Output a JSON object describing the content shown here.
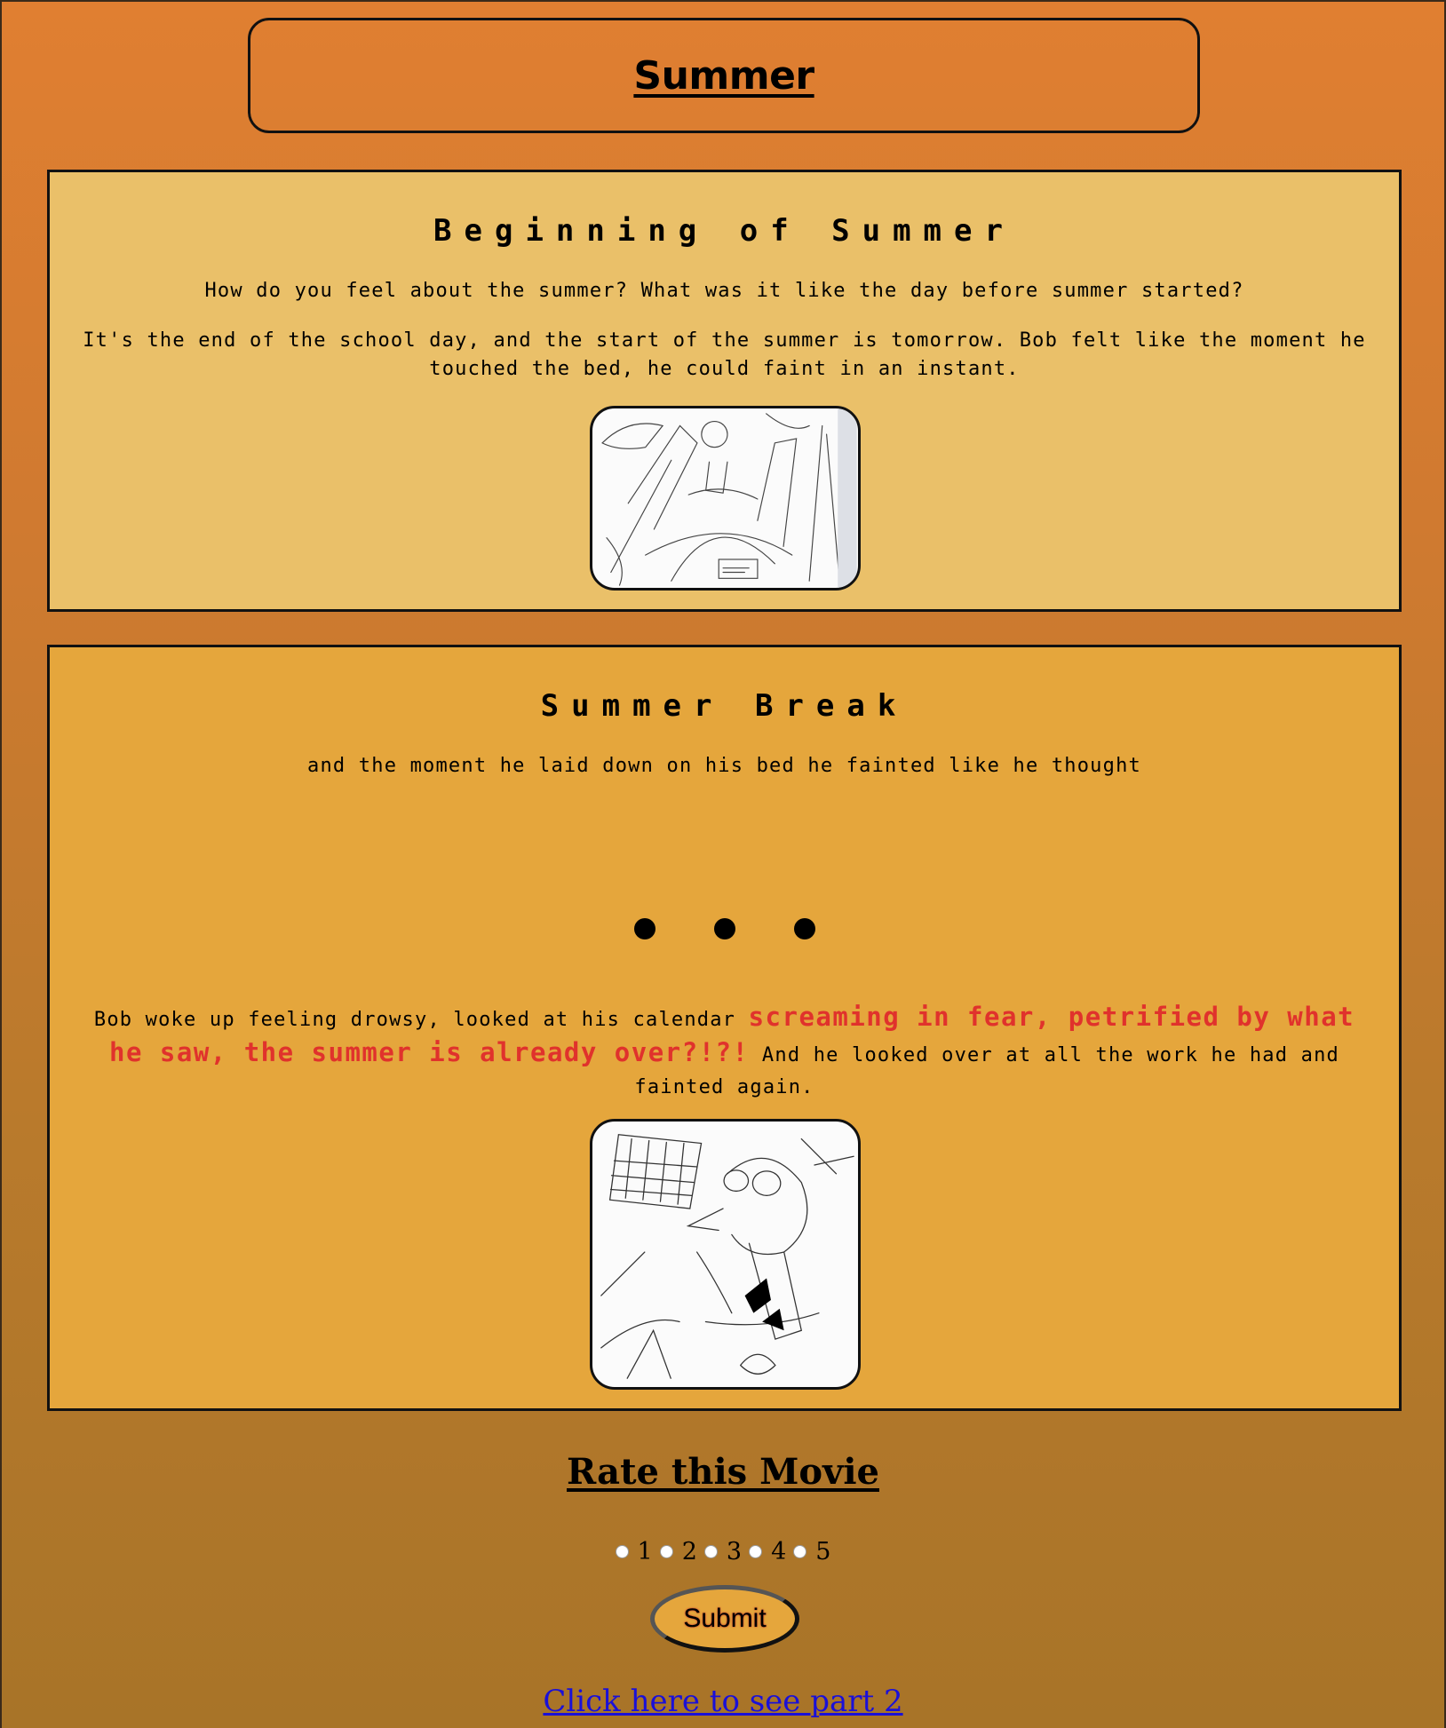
{
  "page": {
    "title": "Summer"
  },
  "sections": [
    {
      "heading": "Beginning of Summer",
      "prompt": "How do you feel about the summer? What was it like the day before summer started?",
      "story": "It's the end of the school day, and the start of the summer is tomorrow. Bob felt like the moment he touched the bed, he could faint in an instant."
    },
    {
      "heading": "Summer Break",
      "intro": "and the moment he laid down on his bed he fainted like he thought",
      "story_before": "Bob woke up feeling drowsy, looked at his calendar ",
      "story_emphasis": "screaming in fear, petrified by what he saw, the summer is already over?!?!",
      "story_after": " And he looked over at all the work he had and fainted again."
    }
  ],
  "rating": {
    "title": "Rate this Movie",
    "options": [
      "1",
      "2",
      "3",
      "4",
      "5"
    ],
    "submit_label": "Submit"
  },
  "footer": {
    "link_text": "Click here to see part 2"
  },
  "colors": {
    "panel_1": "#eac069",
    "panel_2": "#e5a63c",
    "emphasis": "#e0322c",
    "link": "#1a10d8"
  }
}
